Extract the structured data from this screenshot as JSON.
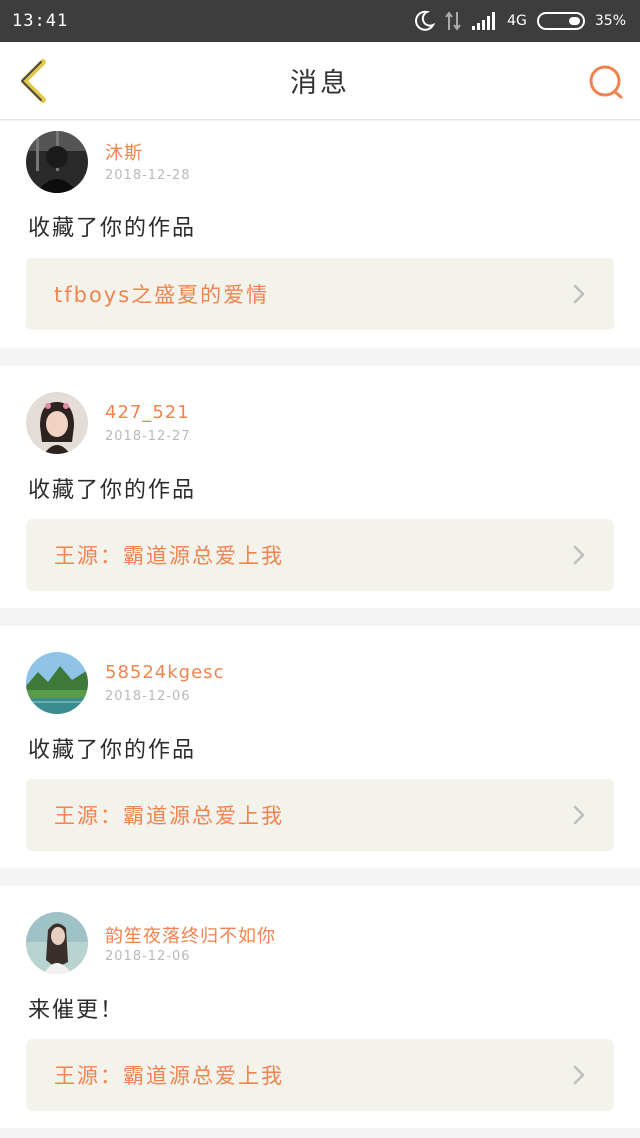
{
  "status_bar": {
    "time": "13:41",
    "network": "4G",
    "battery_pct": "35%",
    "icons": [
      "moon-icon",
      "data-arrows-icon",
      "signal-icon",
      "battery-icon"
    ]
  },
  "nav": {
    "title": "消息",
    "back_icon": "chevron-left-icon",
    "search_icon": "search-icon"
  },
  "colors": {
    "accent": "#f0844e",
    "back_icon": "#e2c94a",
    "status_bar_bg": "#3d3d3d",
    "work_box_bg": "#f3f3ec",
    "page_bg": "#f4f4f4"
  },
  "messages": [
    {
      "username": "沐斯",
      "date": "2018-12-28",
      "action": "收藏了你的作品",
      "work_title": "tfboys之盛夏的爱情",
      "avatar": "dark-portrait-avatar"
    },
    {
      "username": "427_521",
      "date": "2018-12-27",
      "action": "收藏了你的作品",
      "work_title": "王源：霸道源总爱上我",
      "avatar": "girl-portrait-avatar"
    },
    {
      "username": "58524kgesc",
      "date": "2018-12-06",
      "action": "收藏了你的作品",
      "work_title": "王源：霸道源总爱上我",
      "avatar": "landscape-avatar"
    },
    {
      "username": "韵笙夜落终归不如你",
      "date": "2018-12-06",
      "action": "来催更！",
      "work_title": "王源：霸道源总爱上我",
      "avatar": "woman-seaside-avatar"
    }
  ]
}
